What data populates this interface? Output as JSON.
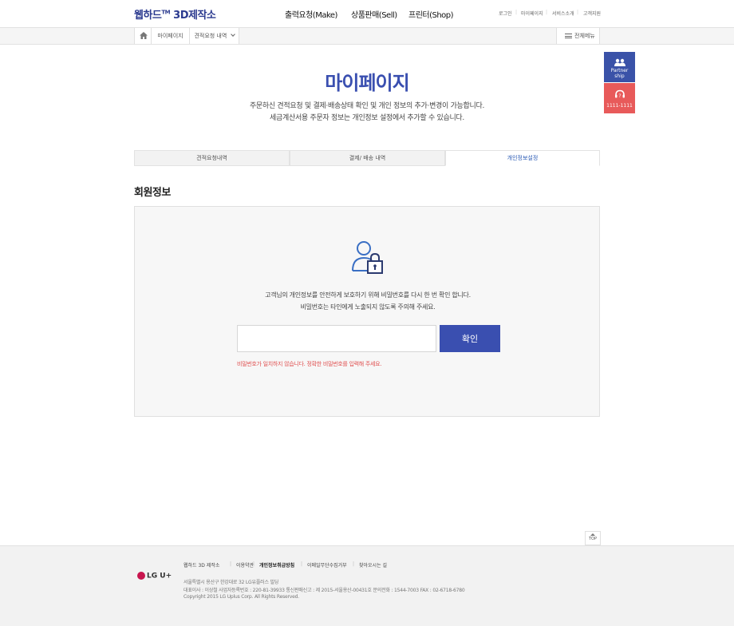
{
  "header": {
    "logo": "웹하드",
    "logo_tm": "TM",
    "logo_suffix": "3D제작소",
    "nav": [
      "출력요청(Make)",
      "상품판매(Sell)",
      "프린터(Shop)"
    ],
    "util": [
      "로그인",
      "마이페이지",
      "서비스소개",
      "고객지원"
    ]
  },
  "location": {
    "items": [
      "마이페이지",
      "견적요청 내역"
    ],
    "all_menu": "전체메뉴"
  },
  "quick": {
    "partner": [
      "Partner",
      "ship"
    ],
    "phone": "1111-1111"
  },
  "page": {
    "title": "마이페이지",
    "desc_line1": "주문하신 견적요청 및 결제·배송상태 확인 및 개인 정보의 추가·변경이 가능합니다.",
    "desc_line2": "세금계산서용 주문자 정보는 개인정보 설정에서 추가할 수 있습니다."
  },
  "tabs": [
    {
      "label": "견적요청내역",
      "active": false
    },
    {
      "label": "결제/ 배송 내역",
      "active": false
    },
    {
      "label": "개인정보설정",
      "active": true
    }
  ],
  "section_title": "회원정보",
  "panel": {
    "msg_line1": "고객님의 개인정보를 안전하게 보호하기 위해 비밀번호를 다시 한 번 확인 합니다.",
    "msg_line2": "비밀번호는 타인에게 노출되지 않도록 주의해 주세요.",
    "password_value": "",
    "confirm_label": "확인",
    "error": "비밀번호가 일치하지 않습니다. 정확한 비밀번호를 입력해 주세요."
  },
  "top_button": "TOP",
  "footer": {
    "logo": "LG U+",
    "links": [
      "웹하드 3D 제작소",
      "이용약관",
      "개인정보취급방침",
      "이메일무단수집거부",
      "찾아오시는 길"
    ],
    "info_line1": "서울특별시 용산구 한강대로 32 LG유플러스 빌딩",
    "info_line2": "대표이사 : 이상철    사업자등록번호 : 220-81-39933    통신판매신고 : 제 2015-서울용산-00431호    문의전화 : 1544-7003    FAX : 02-6718-6780",
    "info_line3": "Copyright 2015 LG Uplus Corp. All Rights Reserved."
  },
  "colors": {
    "brand": "#3a4fb0",
    "error": "#e05050",
    "partner": "#3a52a8",
    "phone": "#e85a5a"
  }
}
